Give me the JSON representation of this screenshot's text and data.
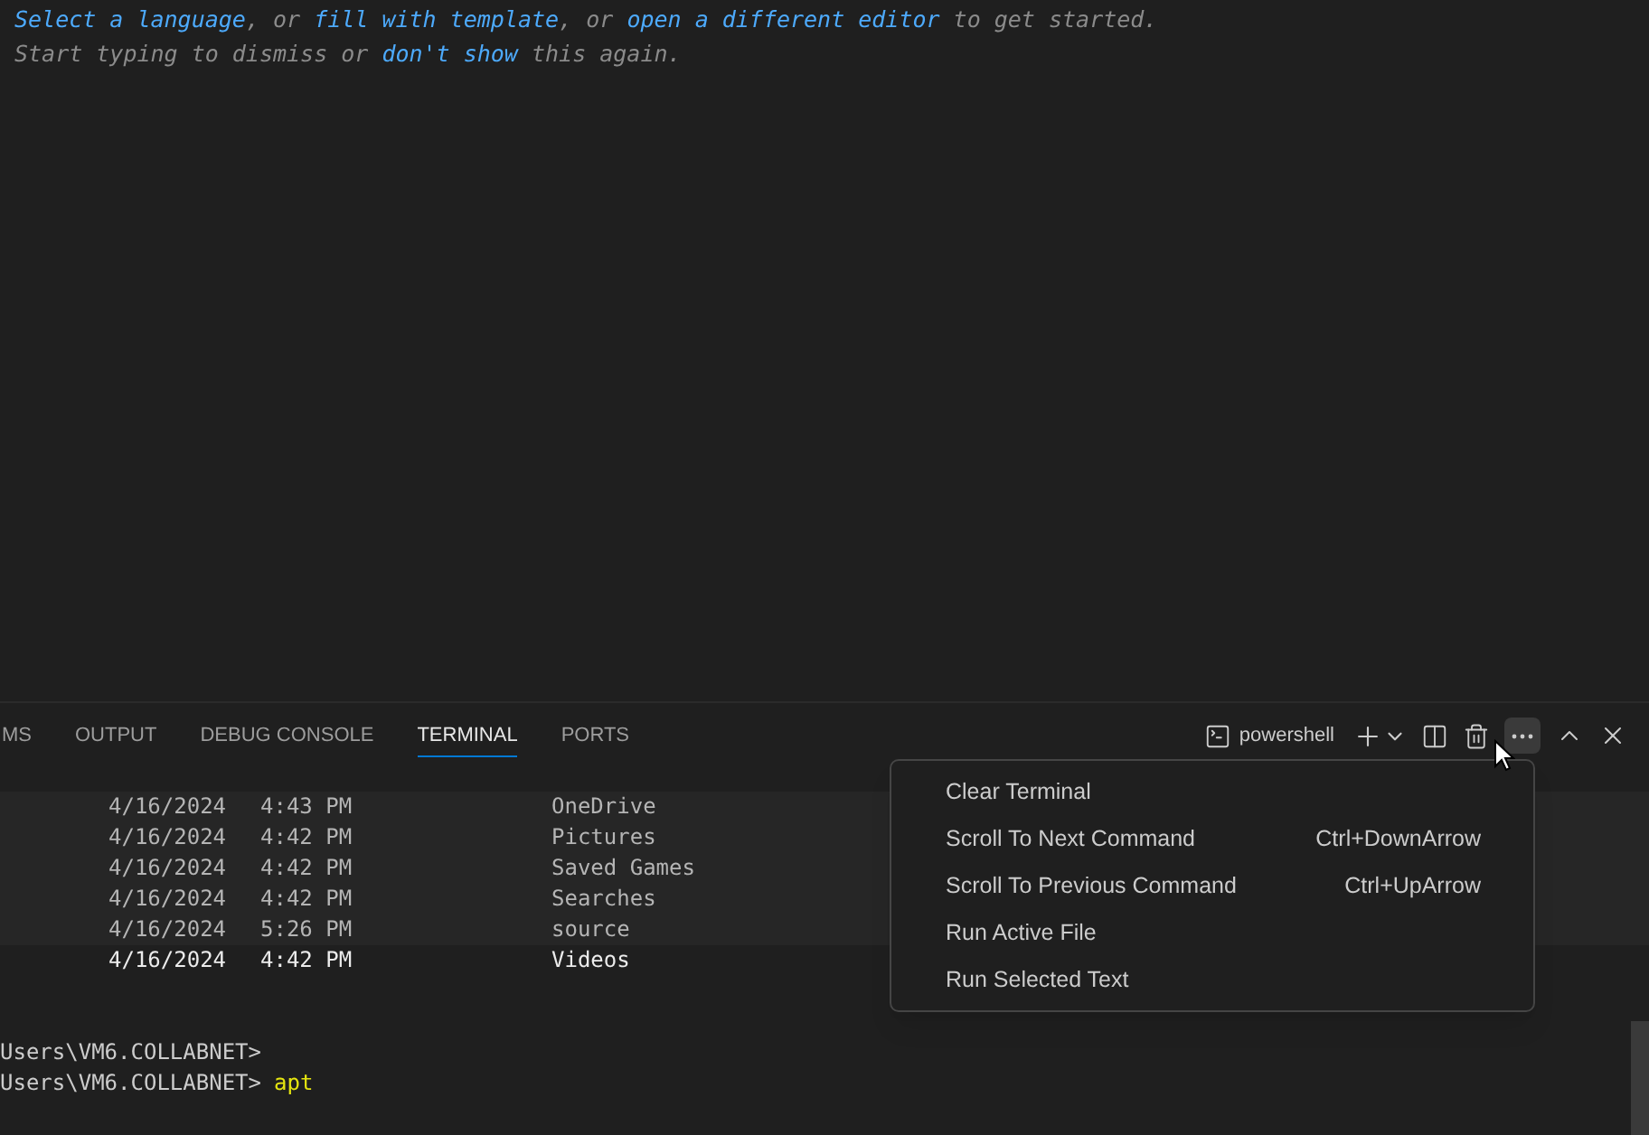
{
  "editor_hint": {
    "lines": [
      [
        {
          "kind": "link",
          "text": "Select a language"
        },
        {
          "kind": "text",
          "text": ", or "
        },
        {
          "kind": "link",
          "text": "fill with template"
        },
        {
          "kind": "text",
          "text": ", or "
        },
        {
          "kind": "link",
          "text": "open a different editor"
        },
        {
          "kind": "text",
          "text": " to get started."
        }
      ],
      [
        {
          "kind": "text",
          "text": "Start typing to dismiss or "
        },
        {
          "kind": "link",
          "text": "don't show"
        },
        {
          "kind": "text",
          "text": " this again."
        }
      ]
    ]
  },
  "panel": {
    "tabs": [
      {
        "label": "MS",
        "selected": false
      },
      {
        "label": "OUTPUT",
        "selected": false
      },
      {
        "label": "DEBUG CONSOLE",
        "selected": false
      },
      {
        "label": "TERMINAL",
        "selected": true
      },
      {
        "label": "PORTS",
        "selected": false
      }
    ],
    "terminal_name": "powershell"
  },
  "terminal": {
    "rows": [
      {
        "date": "4/16/2024",
        "time": "4:43 PM",
        "name": "OneDrive",
        "highlighted": true
      },
      {
        "date": "4/16/2024",
        "time": "4:42 PM",
        "name": "Pictures",
        "highlighted": true
      },
      {
        "date": "4/16/2024",
        "time": "4:42 PM",
        "name": "Saved Games",
        "highlighted": true
      },
      {
        "date": "4/16/2024",
        "time": "4:42 PM",
        "name": "Searches",
        "highlighted": true
      },
      {
        "date": "4/16/2024",
        "time": "5:26 PM",
        "name": "source",
        "highlighted": true
      },
      {
        "date": "4/16/2024",
        "time": "4:42 PM",
        "name": "Videos",
        "highlighted": false
      }
    ],
    "prompts": [
      {
        "prompt": "Users\\VM6.COLLABNET>"
      },
      {
        "prompt": "Users\\VM6.COLLABNET>",
        "command": "apt"
      }
    ]
  },
  "context_menu": {
    "items": [
      {
        "label": "Clear Terminal"
      },
      {
        "label": "Scroll To Next Command",
        "shortcut": "Ctrl+DownArrow"
      },
      {
        "label": "Scroll To Previous Command",
        "shortcut": "Ctrl+UpArrow"
      },
      {
        "label": "Run Active File"
      },
      {
        "label": "Run Selected Text"
      }
    ]
  }
}
